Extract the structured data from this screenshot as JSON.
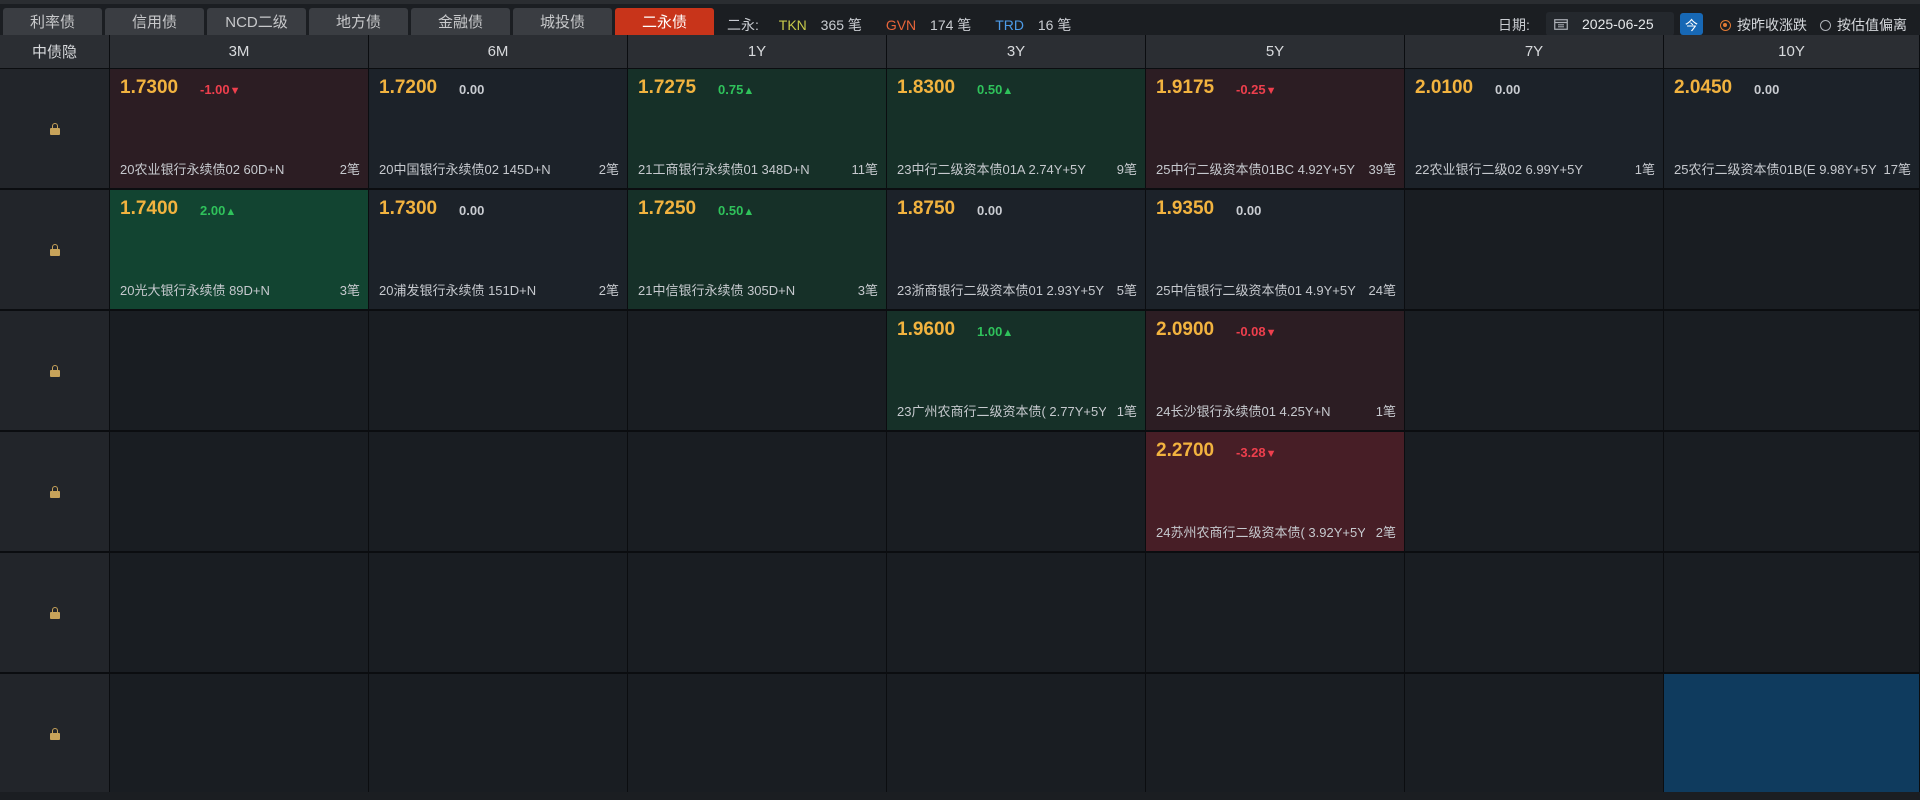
{
  "tabs": [
    "利率债",
    "信用债",
    "NCD二级",
    "地方债",
    "金融债",
    "城投债",
    "二永债"
  ],
  "active_tab": 6,
  "counts": {
    "label": "二永:",
    "tkn_label": "TKN",
    "tkn_value": "365 笔",
    "gvn_label": "GVN",
    "gvn_value": "174 笔",
    "trd_label": "TRD",
    "trd_value": "16 笔"
  },
  "date": {
    "label": "日期:",
    "value": "2025-06-25",
    "today_label": "今"
  },
  "radio": {
    "option1": "按昨收涨跌",
    "option2": "按估值偏离",
    "selected": "option1"
  },
  "colors": {
    "up": "#2fc25b",
    "down": "#ee3f4d",
    "price": "#f2b33f",
    "accent": "#c8341a",
    "selected": "#0f3b5e"
  },
  "grid": {
    "corner_label": "中债隐",
    "columns": [
      "3M",
      "6M",
      "1Y",
      "3Y",
      "5Y",
      "7Y",
      "10Y"
    ],
    "row_count": 6,
    "lock_icon": "lock-icon",
    "cells": [
      {
        "row": 0,
        "col": 0,
        "price": "1.7300",
        "change": "-1.00",
        "dir": "down",
        "bond": "20农业银行永续债02 60D+N",
        "count": "2笔",
        "tone": "down"
      },
      {
        "row": 0,
        "col": 1,
        "price": "1.7200",
        "change": "0.00",
        "dir": "flat",
        "bond": "20中国银行永续债02 145D+N",
        "count": "2笔",
        "tone": "flat"
      },
      {
        "row": 0,
        "col": 2,
        "price": "1.7275",
        "change": "0.75",
        "dir": "up",
        "bond": "21工商银行永续债01 348D+N",
        "count": "11笔",
        "tone": "up"
      },
      {
        "row": 0,
        "col": 3,
        "price": "1.8300",
        "change": "0.50",
        "dir": "up",
        "bond": "23中行二级资本债01A 2.74Y+5Y",
        "count": "9笔",
        "tone": "up"
      },
      {
        "row": 0,
        "col": 4,
        "price": "1.9175",
        "change": "-0.25",
        "dir": "down",
        "bond": "25中行二级资本债01BC 4.92Y+5Y",
        "count": "39笔",
        "tone": "down"
      },
      {
        "row": 0,
        "col": 5,
        "price": "2.0100",
        "change": "0.00",
        "dir": "flat",
        "bond": "22农业银行二级02 6.99Y+5Y",
        "count": "1笔",
        "tone": "flat"
      },
      {
        "row": 0,
        "col": 6,
        "price": "2.0450",
        "change": "0.00",
        "dir": "flat",
        "bond": "25农行二级资本债01B(E 9.98Y+5Y",
        "count": "17笔",
        "tone": "flat"
      },
      {
        "row": 1,
        "col": 0,
        "price": "1.7400",
        "change": "2.00",
        "dir": "up",
        "bond": "20光大银行永续债 89D+N",
        "count": "3笔",
        "tone": "up2"
      },
      {
        "row": 1,
        "col": 1,
        "price": "1.7300",
        "change": "0.00",
        "dir": "flat",
        "bond": "20浦发银行永续债 151D+N",
        "count": "2笔",
        "tone": "flat"
      },
      {
        "row": 1,
        "col": 2,
        "price": "1.7250",
        "change": "0.50",
        "dir": "up",
        "bond": "21中信银行永续债 305D+N",
        "count": "3笔",
        "tone": "up"
      },
      {
        "row": 1,
        "col": 3,
        "price": "1.8750",
        "change": "0.00",
        "dir": "flat",
        "bond": "23浙商银行二级资本债01 2.93Y+5Y",
        "count": "5笔",
        "tone": "flat"
      },
      {
        "row": 1,
        "col": 4,
        "price": "1.9350",
        "change": "0.00",
        "dir": "flat",
        "bond": "25中信银行二级资本债01 4.9Y+5Y",
        "count": "24笔",
        "tone": "flat"
      },
      {
        "row": 2,
        "col": 3,
        "price": "1.9600",
        "change": "1.00",
        "dir": "up",
        "bond": "23广州农商行二级资本债( 2.77Y+5Y",
        "count": "1笔",
        "tone": "up"
      },
      {
        "row": 2,
        "col": 4,
        "price": "2.0900",
        "change": "-0.08",
        "dir": "down",
        "bond": "24长沙银行永续债01 4.25Y+N",
        "count": "1笔",
        "tone": "down"
      },
      {
        "row": 3,
        "col": 4,
        "price": "2.2700",
        "change": "-3.28",
        "dir": "down",
        "bond": "24苏州农商行二级资本债( 3.92Y+5Y",
        "count": "2笔",
        "tone": "down2"
      }
    ],
    "selected_cell": {
      "row": 5,
      "col": 6
    }
  }
}
